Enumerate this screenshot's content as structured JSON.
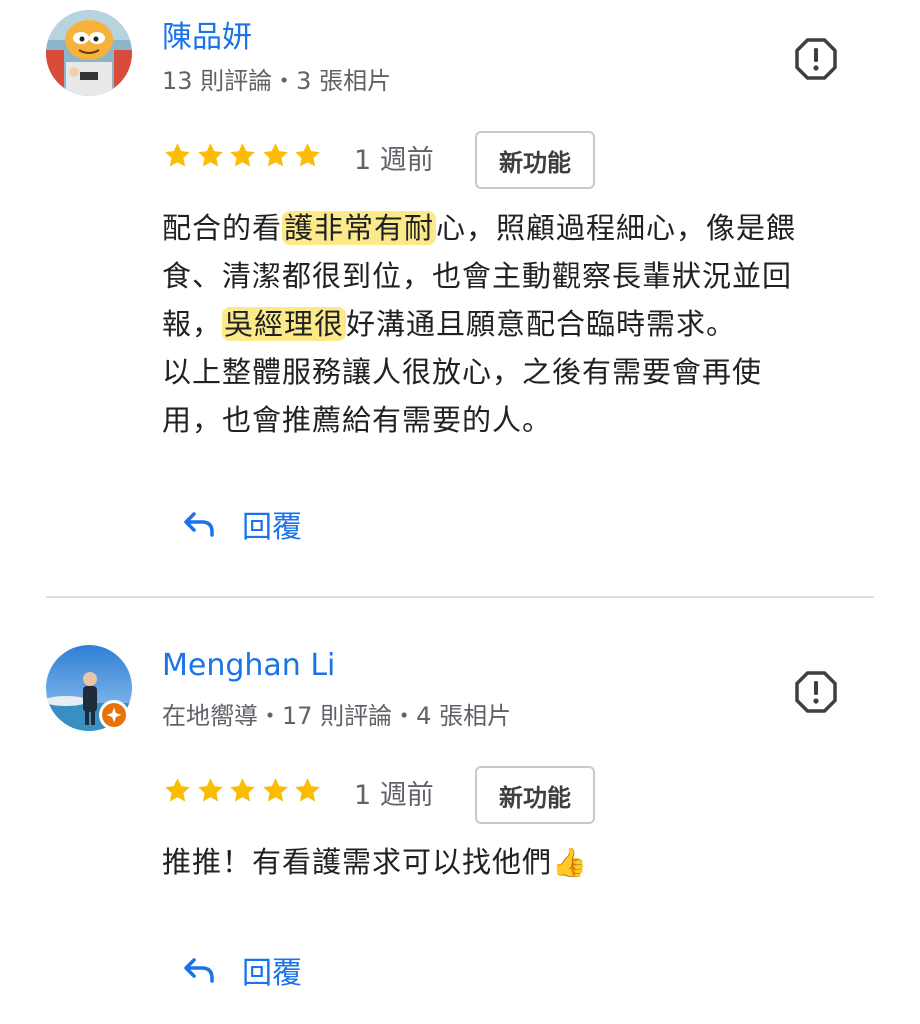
{
  "reviews": [
    {
      "author": "陳品妍",
      "meta": "13 則評論・3 張相片",
      "rating": 5,
      "time": "1 週前",
      "new_label": "新功能",
      "body_lines": [
        {
          "pre": "配合的看",
          "hl": "護非常有耐",
          "post": "心，照顧過程細心，像是餵"
        },
        {
          "pre": "食、清潔都很到位，也會主動觀察長輩狀況並回",
          "hl": "",
          "post": ""
        },
        {
          "pre": "報，",
          "hl": "吳經理很",
          "post": "好溝通且願意配合臨時需求。"
        },
        {
          "pre": "以上整體服務讓人很放心，之後有需要會再使",
          "hl": "",
          "post": ""
        },
        {
          "pre": "用，也會推薦給有需要的人。",
          "hl": "",
          "post": ""
        }
      ],
      "reply_label": "回覆",
      "avatar_icon": "garfield-avatar"
    },
    {
      "author": "Menghan Li",
      "meta": "在地嚮導・17 則評論・4 張相片",
      "rating": 5,
      "time": "1 週前",
      "new_label": "新功能",
      "body_lines": [
        {
          "pre": "推推！有看護需求可以找他們",
          "hl": "",
          "post": ""
        }
      ],
      "emoji": "👍",
      "reply_label": "回覆",
      "avatar_icon": "beach-photo-avatar",
      "badge_icon": "local-guide-star-icon"
    }
  ],
  "colors": {
    "accent": "#1a73e8",
    "star": "#fbbc04",
    "highlight": "#fbe98a",
    "badge": "#e8710a"
  }
}
